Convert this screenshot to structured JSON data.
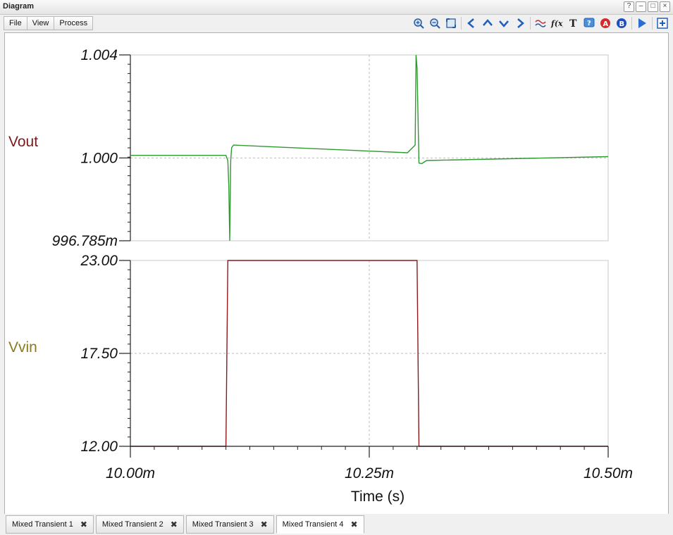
{
  "window": {
    "title": "Diagram"
  },
  "menu": {
    "items": [
      "File",
      "View",
      "Process"
    ]
  },
  "toolbar_icons": [
    "zoom-in-icon",
    "zoom-out-icon",
    "fit-view-icon",
    "arrow-left-icon",
    "arrow-up-icon",
    "arrow-down-icon",
    "arrow-right-icon",
    "wave-icon",
    "function-icon",
    "text-icon",
    "help-icon",
    "cursor-a-icon",
    "cursor-b-icon",
    "play-icon",
    "add-window-icon"
  ],
  "tabs": [
    {
      "label": "Mixed Transient 1",
      "active": false
    },
    {
      "label": "Mixed Transient 2",
      "active": false
    },
    {
      "label": "Mixed Transient 3",
      "active": false
    },
    {
      "label": "Mixed Transient 4",
      "active": true
    }
  ],
  "chart_data": [
    {
      "type": "line",
      "ylabel": "Vout",
      "ylabel_color": "#7a1a1a",
      "line_color": "#2f9a2f",
      "ylim": [
        0.996785,
        1.004
      ],
      "ytick_values": [
        0.996785,
        1.0,
        1.004
      ],
      "ytick_labels": [
        "996.785m",
        "1.000",
        "1.004"
      ],
      "x": [
        0.01,
        0.0101,
        0.010102,
        0.010103,
        0.010104,
        0.010105,
        0.010106,
        0.010108,
        0.01029,
        0.010298,
        0.010299,
        0.0103,
        0.010302,
        0.010305,
        0.01031,
        0.0105
      ],
      "values": [
        1.0001,
        1.0001,
        0.9999,
        0.9989,
        0.996785,
        0.9999,
        1.0004,
        1.0005,
        1.0002,
        1.0005,
        1.004,
        1.0035,
        0.9998,
        0.99978,
        0.9999,
        1.00005
      ]
    },
    {
      "type": "line",
      "ylabel": "Vvin",
      "ylabel_color": "#8c7a1a",
      "line_color": "#8b1a1a",
      "ylim": [
        12.0,
        23.0
      ],
      "ytick_values": [
        12.0,
        17.5,
        23.0
      ],
      "ytick_labels": [
        "12.00",
        "17.50",
        "23.00"
      ],
      "x": [
        0.01,
        0.0101,
        0.010102,
        0.0103,
        0.010302,
        0.0105
      ],
      "values": [
        12.0,
        12.0,
        23.0,
        23.0,
        12.0,
        12.0
      ]
    }
  ],
  "x_axis": {
    "xlabel": "Time (s)",
    "xlim": [
      0.01,
      0.0105
    ],
    "tick_values": [
      0.01,
      0.01025,
      0.0105
    ],
    "tick_labels": [
      "10.00m",
      "10.25m",
      "10.50m"
    ]
  }
}
